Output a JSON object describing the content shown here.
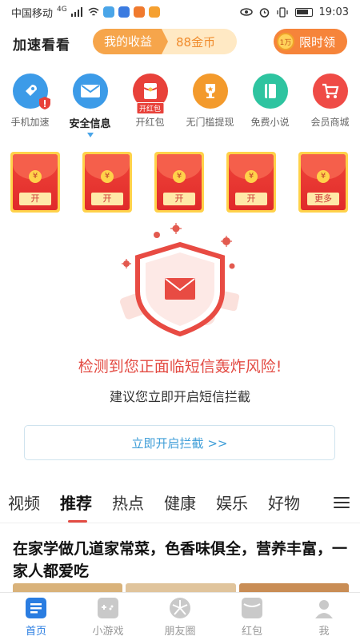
{
  "status_bar": {
    "carrier": "中国移动",
    "network": "4G",
    "time": "19:03"
  },
  "header": {
    "app_title": "加速看看",
    "earnings_label": "我的收益",
    "earnings_value": "88金币",
    "coin_text": "1万",
    "limited_label": "限时领"
  },
  "quick_icons": [
    {
      "label": "手机加速",
      "icon": "rocket-icon",
      "color": "#3c9be8"
    },
    {
      "label": "安全信息",
      "icon": "mail-icon",
      "color": "#3c9be8",
      "active": true
    },
    {
      "label": "开红包",
      "icon": "red-packet-icon",
      "color": "#e8413a",
      "badge": "开红包"
    },
    {
      "label": "无门槛提现",
      "icon": "trophy-icon",
      "color": "#f39a2c"
    },
    {
      "label": "免费小说",
      "icon": "book-icon",
      "color": "#2ec4a0"
    },
    {
      "label": "会员商城",
      "icon": "cart-icon",
      "color": "#ef4b46"
    }
  ],
  "envelopes": [
    {
      "button": "开"
    },
    {
      "button": "开"
    },
    {
      "button": "开"
    },
    {
      "button": "开"
    },
    {
      "button": "更多"
    }
  ],
  "alert": {
    "title": "检测到您正面临短信轰炸风险!",
    "subtitle": "建议您立即开启短信拦截",
    "action": "立即开启拦截 >>"
  },
  "tabs": [
    {
      "label": "视频"
    },
    {
      "label": "推荐",
      "active": true
    },
    {
      "label": "热点"
    },
    {
      "label": "健康"
    },
    {
      "label": "娱乐"
    },
    {
      "label": "好物"
    }
  ],
  "article": {
    "title": "在家学做几道家常菜，色香味俱全，营养丰富，一家人都爱吃"
  },
  "bottom_nav": [
    {
      "label": "首页",
      "icon": "home-icon",
      "active": true
    },
    {
      "label": "小游戏",
      "icon": "gamepad-icon"
    },
    {
      "label": "朋友圈",
      "icon": "aperture-icon"
    },
    {
      "label": "红包",
      "icon": "red-packet-icon"
    },
    {
      "label": "我",
      "icon": "user-icon"
    }
  ]
}
